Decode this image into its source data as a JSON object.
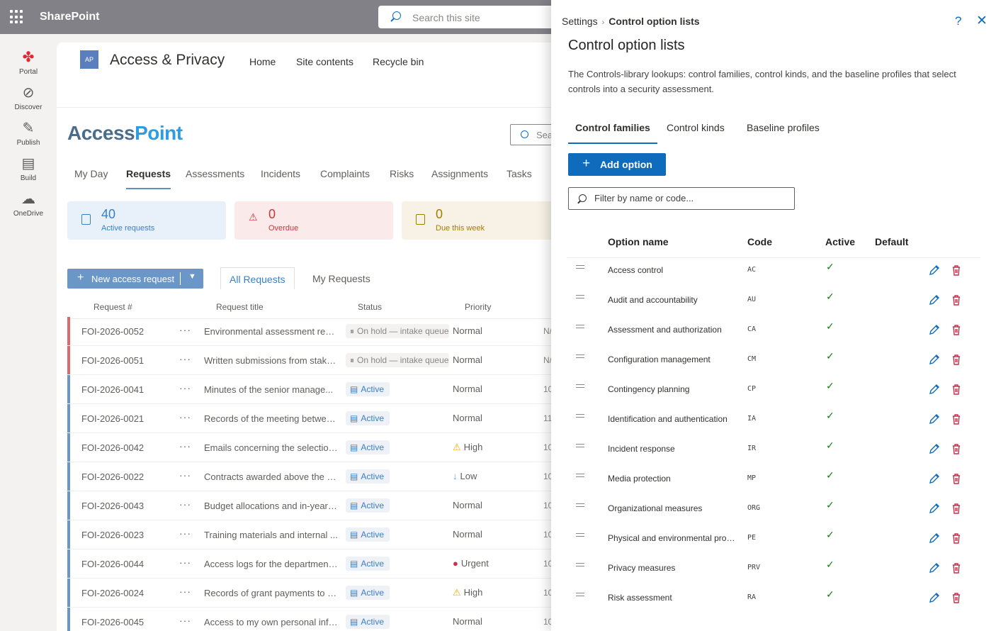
{
  "suite": {
    "brand": "SharePoint",
    "search_placeholder": "Search this site"
  },
  "appbar": [
    {
      "label": "Portal",
      "icon": "maple-leaf-icon"
    },
    {
      "label": "Discover",
      "icon": "compass-icon"
    },
    {
      "label": "Publish",
      "icon": "pen-icon"
    },
    {
      "label": "Build",
      "icon": "layout-icon"
    },
    {
      "label": "OneDrive",
      "icon": "cloud-icon"
    }
  ],
  "site": {
    "logo": "AP",
    "title": "Access & Privacy",
    "nav": [
      "Home",
      "Site contents",
      "Recycle bin"
    ],
    "app_logo_a": "Access",
    "app_logo_b": "Point",
    "search_placeholder": "Sea",
    "tabs": [
      "My Day",
      "Requests",
      "Assessments",
      "Incidents",
      "Complaints",
      "Risks",
      "Assignments",
      "Tasks"
    ],
    "active_tab": "Requests",
    "stats": [
      {
        "value": "40",
        "label": "Active requests",
        "color": "#3a7fc4",
        "bg": "#e8f1fa"
      },
      {
        "value": "0",
        "label": "Overdue",
        "color": "#d13438",
        "bg": "#fbeaea"
      },
      {
        "value": "0",
        "label": "Due this week",
        "color": "#a67c00",
        "bg": "#f8f2e6"
      }
    ],
    "new_button": "New access request",
    "views": [
      "All Requests",
      "My Requests"
    ],
    "columns": [
      "Request #",
      "Request title",
      "Status",
      "Priority"
    ],
    "rows": [
      {
        "id": "FOI-2026-0052",
        "title": "Environmental assessment reco...",
        "status": "On hold — intake queue",
        "hold": true,
        "priority": "Normal",
        "pico": "",
        "tail": "N/",
        "bar": "#d96b6b"
      },
      {
        "id": "FOI-2026-0051",
        "title": "Written submissions from stake...",
        "status": "On hold — intake queue",
        "hold": true,
        "priority": "Normal",
        "pico": "",
        "tail": "N/",
        "bar": "#d96b6b"
      },
      {
        "id": "FOI-2026-0041",
        "title": "Minutes of the senior manage...",
        "status": "Active",
        "hold": false,
        "priority": "Normal",
        "pico": "",
        "tail": "10",
        "bar": "#6a97c8"
      },
      {
        "id": "FOI-2026-0021",
        "title": "Records of the meeting betwee...",
        "status": "Active",
        "hold": false,
        "priority": "Normal",
        "pico": "",
        "tail": "11",
        "bar": "#6a97c8"
      },
      {
        "id": "FOI-2026-0042",
        "title": "Emails concerning the selection...",
        "status": "Active",
        "hold": false,
        "priority": "High",
        "pico": "⚠",
        "pcolor": "#f2a900",
        "tail": "10",
        "bar": "#6a97c8"
      },
      {
        "id": "FOI-2026-0022",
        "title": "Contracts awarded above the p...",
        "status": "Active",
        "hold": false,
        "priority": "Low",
        "pico": "↓",
        "pcolor": "#6a97c8",
        "tail": "10",
        "bar": "#6a97c8"
      },
      {
        "id": "FOI-2026-0043",
        "title": "Budget allocations and in-year r...",
        "status": "Active",
        "hold": false,
        "priority": "Normal",
        "pico": "",
        "tail": "10",
        "bar": "#6a97c8"
      },
      {
        "id": "FOI-2026-0023",
        "title": "Training materials and internal ...",
        "status": "Active",
        "hold": false,
        "priority": "Normal",
        "pico": "",
        "tail": "10",
        "bar": "#6a97c8"
      },
      {
        "id": "FOI-2026-0044",
        "title": "Access logs for the department...",
        "status": "Active",
        "hold": false,
        "priority": "Urgent",
        "pico": "●",
        "pcolor": "#c4314b",
        "tail": "10",
        "bar": "#6a97c8"
      },
      {
        "id": "FOI-2026-0024",
        "title": "Records of grant payments to a...",
        "status": "Active",
        "hold": false,
        "priority": "High",
        "pico": "⚠",
        "pcolor": "#f2a900",
        "tail": "10",
        "bar": "#6a97c8"
      },
      {
        "id": "FOI-2026-0045",
        "title": "Access to my own personal info...",
        "status": "Active",
        "hold": false,
        "priority": "Normal",
        "pico": "",
        "tail": "10",
        "bar": "#6a97c8"
      }
    ]
  },
  "panel": {
    "crumb_root": "Settings",
    "crumb_sep": "›",
    "crumb_current": "Control option lists",
    "help": "?",
    "close": "✕",
    "title": "Control option lists",
    "description": "The Controls-library lookups: control families, control kinds, and the baseline profiles that select controls into a security assessment.",
    "tabs": [
      "Control families",
      "Control kinds",
      "Baseline profiles"
    ],
    "add_label": "Add option",
    "filter_placeholder": "Filter by name or code...",
    "columns": [
      "Option name",
      "Code",
      "Active",
      "Default"
    ],
    "options": [
      {
        "name": "Access control",
        "code": "AC",
        "active": true
      },
      {
        "name": "Audit and accountability",
        "code": "AU",
        "active": true
      },
      {
        "name": "Assessment and authorization",
        "code": "CA",
        "active": true
      },
      {
        "name": "Configuration management",
        "code": "CM",
        "active": true
      },
      {
        "name": "Contingency planning",
        "code": "CP",
        "active": true
      },
      {
        "name": "Identification and authentication",
        "code": "IA",
        "active": true
      },
      {
        "name": "Incident response",
        "code": "IR",
        "active": true
      },
      {
        "name": "Media protection",
        "code": "MP",
        "active": true
      },
      {
        "name": "Organizational measures",
        "code": "ORG",
        "active": true
      },
      {
        "name": "Physical and environmental protection",
        "code": "PE",
        "active": true
      },
      {
        "name": "Privacy measures",
        "code": "PRV",
        "active": true
      },
      {
        "name": "Risk assessment",
        "code": "RA",
        "active": true
      }
    ]
  }
}
